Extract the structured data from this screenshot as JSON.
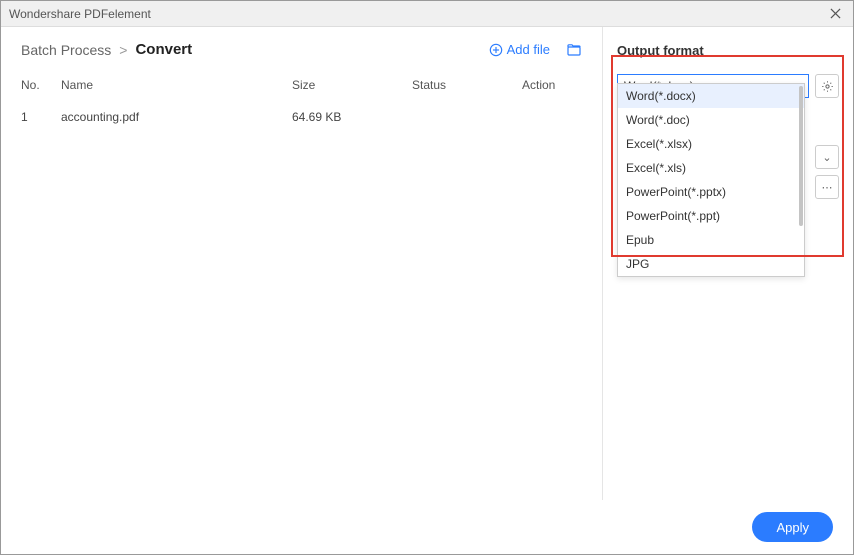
{
  "titlebar": {
    "title": "Wondershare PDFelement"
  },
  "breadcrumb": {
    "parent": "Batch Process",
    "current": "Convert",
    "sep": ">"
  },
  "addfile": {
    "label": "Add file"
  },
  "table": {
    "headers": {
      "no": "No.",
      "name": "Name",
      "size": "Size",
      "status": "Status",
      "action": "Action"
    },
    "rows": [
      {
        "no": "1",
        "name": "accounting.pdf",
        "size": "64.69 KB",
        "status": "",
        "action": ""
      }
    ]
  },
  "panel": {
    "title": "Output format",
    "selected": "Word(*.docx)",
    "options": [
      "Word(*.docx)",
      "Word(*.doc)",
      "Excel(*.xlsx)",
      "Excel(*.xls)",
      "PowerPoint(*.pptx)",
      "PowerPoint(*.ppt)",
      "Epub",
      "JPG"
    ]
  },
  "footer": {
    "apply": "Apply"
  }
}
